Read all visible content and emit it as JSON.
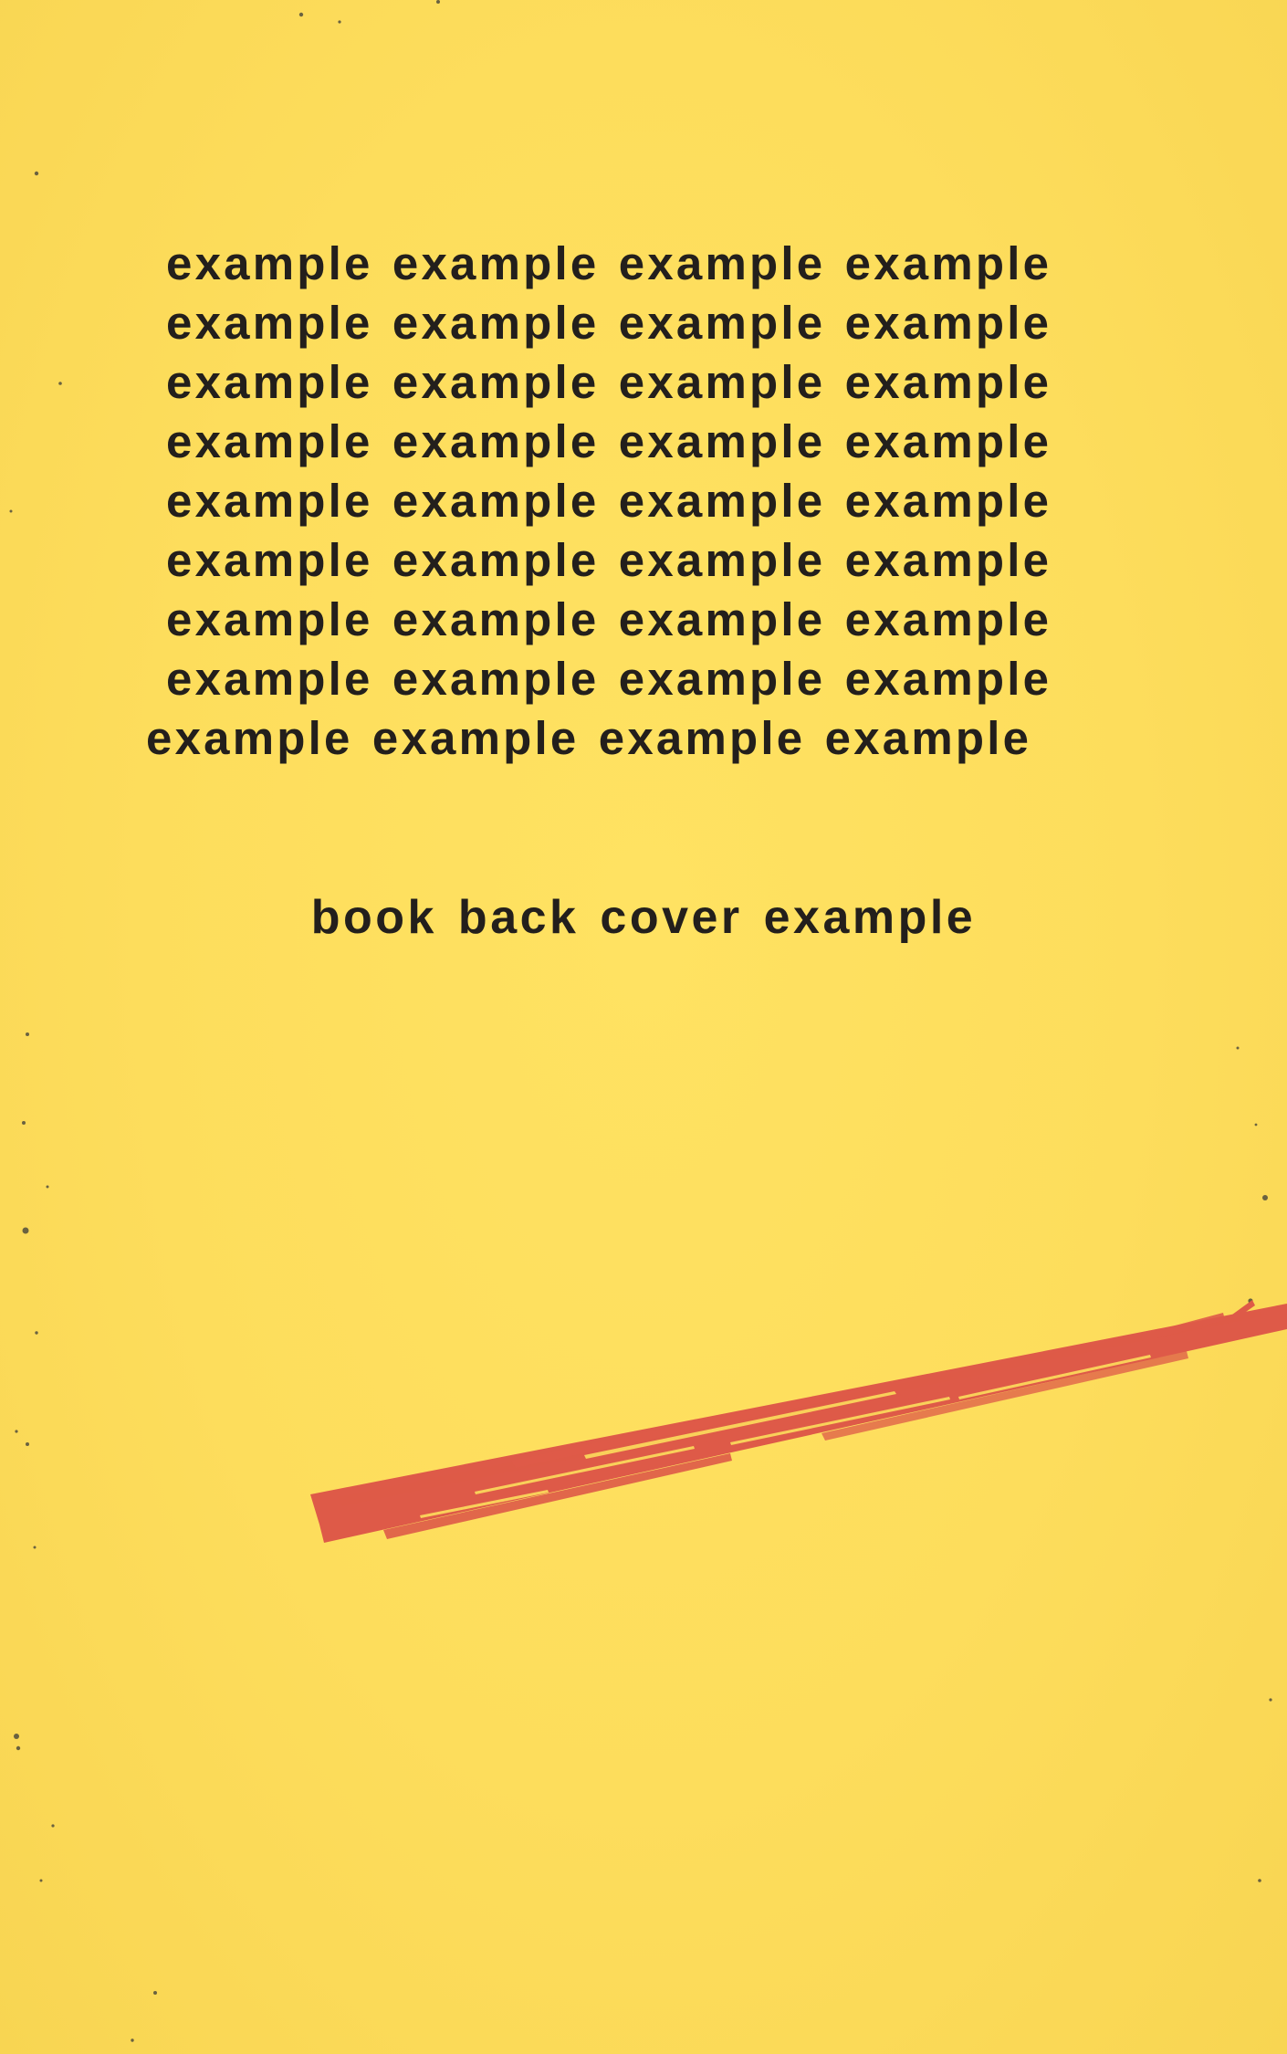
{
  "cover": {
    "background_color": "#FDDD5C",
    "text_color": "#231F1C",
    "accent_color": "#DE5A48",
    "body_lines": [
      "example example example example",
      "example example example example",
      "example example example example",
      "example example example example",
      "example example example example",
      "example example example example",
      "example example example example",
      "example example example example",
      "example example example example"
    ],
    "subtitle": "book back cover example"
  }
}
